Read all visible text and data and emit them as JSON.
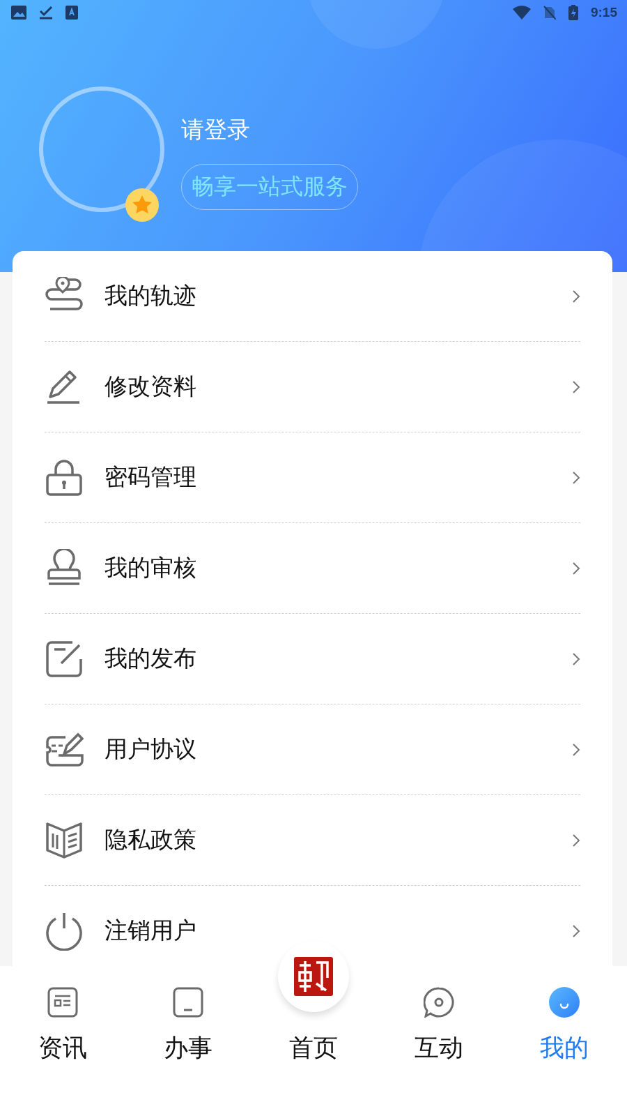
{
  "status_bar": {
    "time": "9:15"
  },
  "profile": {
    "title": "请登录",
    "subtitle": "畅享一站式服务"
  },
  "menu": [
    {
      "label": "我的轨迹"
    },
    {
      "label": "修改资料"
    },
    {
      "label": "密码管理"
    },
    {
      "label": "我的审核"
    },
    {
      "label": "我的发布"
    },
    {
      "label": "用户协议"
    },
    {
      "label": "隐私政策"
    },
    {
      "label": "注销用户"
    }
  ],
  "bottom_nav": [
    {
      "label": "资讯",
      "kind": "tab",
      "selected": false
    },
    {
      "label": "办事",
      "kind": "tab",
      "selected": false
    },
    {
      "label": "首页",
      "kind": "center",
      "selected": false
    },
    {
      "label": "互动",
      "kind": "tab",
      "selected": false
    },
    {
      "label": "我的",
      "kind": "tab",
      "selected": true
    }
  ]
}
